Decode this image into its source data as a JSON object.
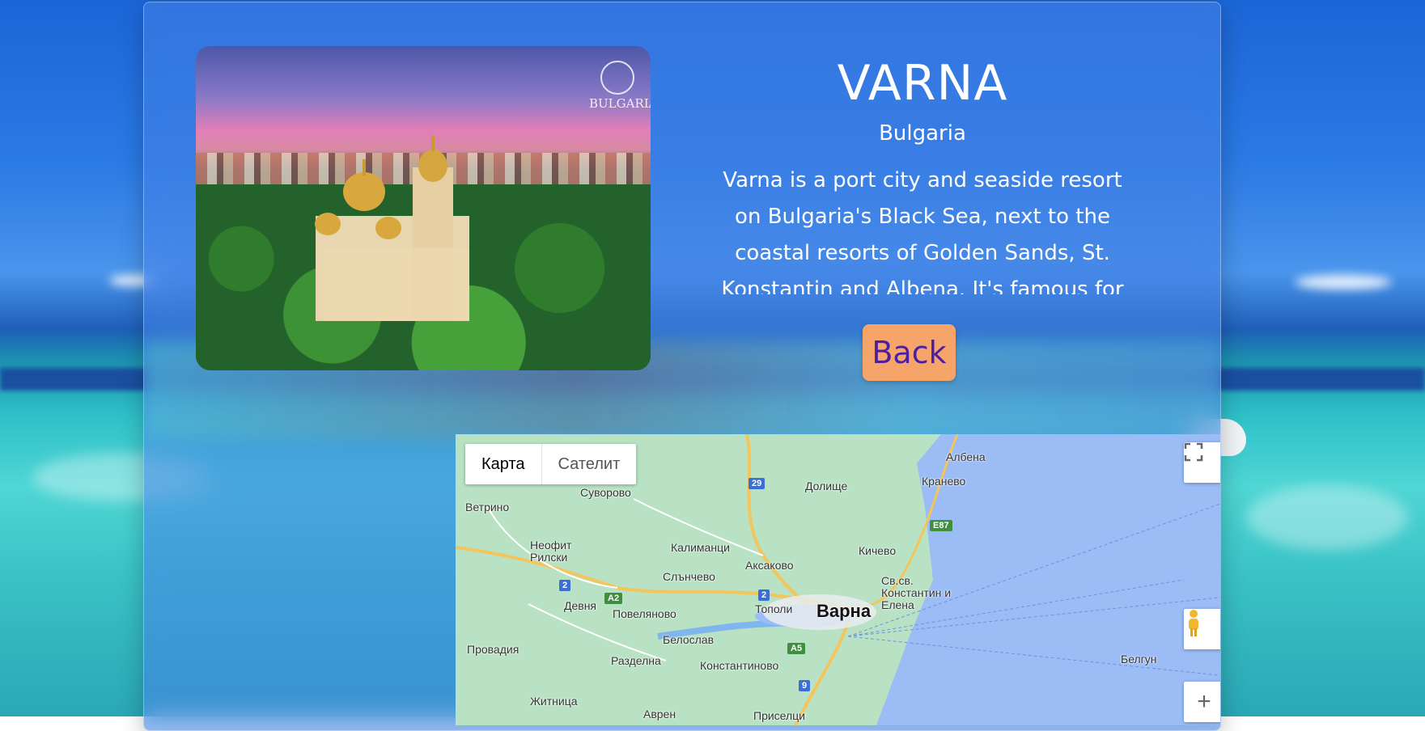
{
  "city": {
    "name": "VARNA",
    "country": "Bulgaria",
    "description": "Varna is a port city and seaside resort on Bulgaria's Black Sea, next to the coastal resorts of Golden Sands, St. Konstantin and Albena. It's famous for the \"Gold of Varna.\"",
    "photo_logo_text": "BULGARIA"
  },
  "actions": {
    "back_label": "Back"
  },
  "map": {
    "type_buttons": {
      "map": "Карта",
      "satellite": "Сателит"
    },
    "zoom_in_label": "+",
    "places": [
      "Албена",
      "Кранево",
      "Долище",
      "Суворово",
      "Ветрино",
      "Неофит Рилски",
      "Калиманци",
      "Кичево",
      "Аксаково",
      "Слънчево",
      "Св.св. Константин и Елена",
      "Девня",
      "Повеляново",
      "Тополи",
      "Варна",
      "Провадия",
      "Белослав",
      "Разделна",
      "Константиново",
      "Белгун",
      "Житница",
      "Аврен",
      "Приселци"
    ],
    "road_shields": [
      "29",
      "E87",
      "2",
      "A2",
      "2",
      "A5",
      "9"
    ]
  },
  "colors": {
    "back_button_bg": "#f5a46a",
    "back_button_text": "#4b1fa0",
    "map_land": "#b9e2c4",
    "map_sea": "#9bbcf5"
  }
}
